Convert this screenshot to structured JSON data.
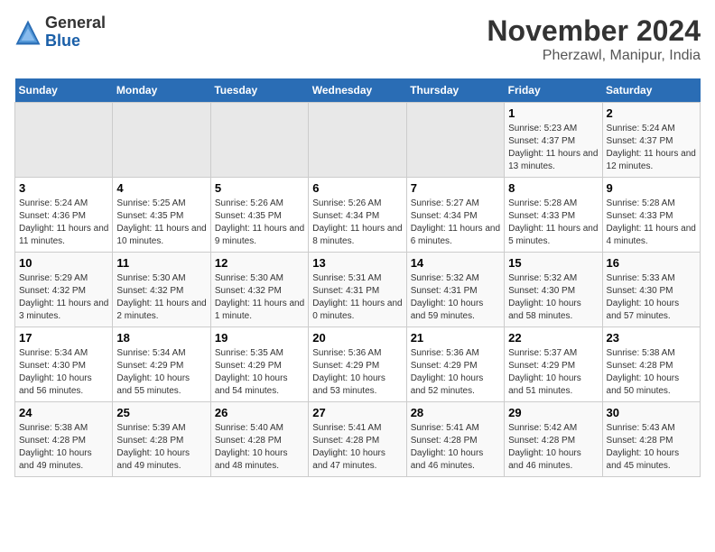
{
  "logo": {
    "general": "General",
    "blue": "Blue"
  },
  "header": {
    "title": "November 2024",
    "subtitle": "Pherzawl, Manipur, India"
  },
  "weekdays": [
    "Sunday",
    "Monday",
    "Tuesday",
    "Wednesday",
    "Thursday",
    "Friday",
    "Saturday"
  ],
  "weeks": [
    [
      {
        "day": "",
        "info": ""
      },
      {
        "day": "",
        "info": ""
      },
      {
        "day": "",
        "info": ""
      },
      {
        "day": "",
        "info": ""
      },
      {
        "day": "",
        "info": ""
      },
      {
        "day": "1",
        "info": "Sunrise: 5:23 AM\nSunset: 4:37 PM\nDaylight: 11 hours and 13 minutes."
      },
      {
        "day": "2",
        "info": "Sunrise: 5:24 AM\nSunset: 4:37 PM\nDaylight: 11 hours and 12 minutes."
      }
    ],
    [
      {
        "day": "3",
        "info": "Sunrise: 5:24 AM\nSunset: 4:36 PM\nDaylight: 11 hours and 11 minutes."
      },
      {
        "day": "4",
        "info": "Sunrise: 5:25 AM\nSunset: 4:35 PM\nDaylight: 11 hours and 10 minutes."
      },
      {
        "day": "5",
        "info": "Sunrise: 5:26 AM\nSunset: 4:35 PM\nDaylight: 11 hours and 9 minutes."
      },
      {
        "day": "6",
        "info": "Sunrise: 5:26 AM\nSunset: 4:34 PM\nDaylight: 11 hours and 8 minutes."
      },
      {
        "day": "7",
        "info": "Sunrise: 5:27 AM\nSunset: 4:34 PM\nDaylight: 11 hours and 6 minutes."
      },
      {
        "day": "8",
        "info": "Sunrise: 5:28 AM\nSunset: 4:33 PM\nDaylight: 11 hours and 5 minutes."
      },
      {
        "day": "9",
        "info": "Sunrise: 5:28 AM\nSunset: 4:33 PM\nDaylight: 11 hours and 4 minutes."
      }
    ],
    [
      {
        "day": "10",
        "info": "Sunrise: 5:29 AM\nSunset: 4:32 PM\nDaylight: 11 hours and 3 minutes."
      },
      {
        "day": "11",
        "info": "Sunrise: 5:30 AM\nSunset: 4:32 PM\nDaylight: 11 hours and 2 minutes."
      },
      {
        "day": "12",
        "info": "Sunrise: 5:30 AM\nSunset: 4:32 PM\nDaylight: 11 hours and 1 minute."
      },
      {
        "day": "13",
        "info": "Sunrise: 5:31 AM\nSunset: 4:31 PM\nDaylight: 11 hours and 0 minutes."
      },
      {
        "day": "14",
        "info": "Sunrise: 5:32 AM\nSunset: 4:31 PM\nDaylight: 10 hours and 59 minutes."
      },
      {
        "day": "15",
        "info": "Sunrise: 5:32 AM\nSunset: 4:30 PM\nDaylight: 10 hours and 58 minutes."
      },
      {
        "day": "16",
        "info": "Sunrise: 5:33 AM\nSunset: 4:30 PM\nDaylight: 10 hours and 57 minutes."
      }
    ],
    [
      {
        "day": "17",
        "info": "Sunrise: 5:34 AM\nSunset: 4:30 PM\nDaylight: 10 hours and 56 minutes."
      },
      {
        "day": "18",
        "info": "Sunrise: 5:34 AM\nSunset: 4:29 PM\nDaylight: 10 hours and 55 minutes."
      },
      {
        "day": "19",
        "info": "Sunrise: 5:35 AM\nSunset: 4:29 PM\nDaylight: 10 hours and 54 minutes."
      },
      {
        "day": "20",
        "info": "Sunrise: 5:36 AM\nSunset: 4:29 PM\nDaylight: 10 hours and 53 minutes."
      },
      {
        "day": "21",
        "info": "Sunrise: 5:36 AM\nSunset: 4:29 PM\nDaylight: 10 hours and 52 minutes."
      },
      {
        "day": "22",
        "info": "Sunrise: 5:37 AM\nSunset: 4:29 PM\nDaylight: 10 hours and 51 minutes."
      },
      {
        "day": "23",
        "info": "Sunrise: 5:38 AM\nSunset: 4:28 PM\nDaylight: 10 hours and 50 minutes."
      }
    ],
    [
      {
        "day": "24",
        "info": "Sunrise: 5:38 AM\nSunset: 4:28 PM\nDaylight: 10 hours and 49 minutes."
      },
      {
        "day": "25",
        "info": "Sunrise: 5:39 AM\nSunset: 4:28 PM\nDaylight: 10 hours and 49 minutes."
      },
      {
        "day": "26",
        "info": "Sunrise: 5:40 AM\nSunset: 4:28 PM\nDaylight: 10 hours and 48 minutes."
      },
      {
        "day": "27",
        "info": "Sunrise: 5:41 AM\nSunset: 4:28 PM\nDaylight: 10 hours and 47 minutes."
      },
      {
        "day": "28",
        "info": "Sunrise: 5:41 AM\nSunset: 4:28 PM\nDaylight: 10 hours and 46 minutes."
      },
      {
        "day": "29",
        "info": "Sunrise: 5:42 AM\nSunset: 4:28 PM\nDaylight: 10 hours and 46 minutes."
      },
      {
        "day": "30",
        "info": "Sunrise: 5:43 AM\nSunset: 4:28 PM\nDaylight: 10 hours and 45 minutes."
      }
    ]
  ]
}
